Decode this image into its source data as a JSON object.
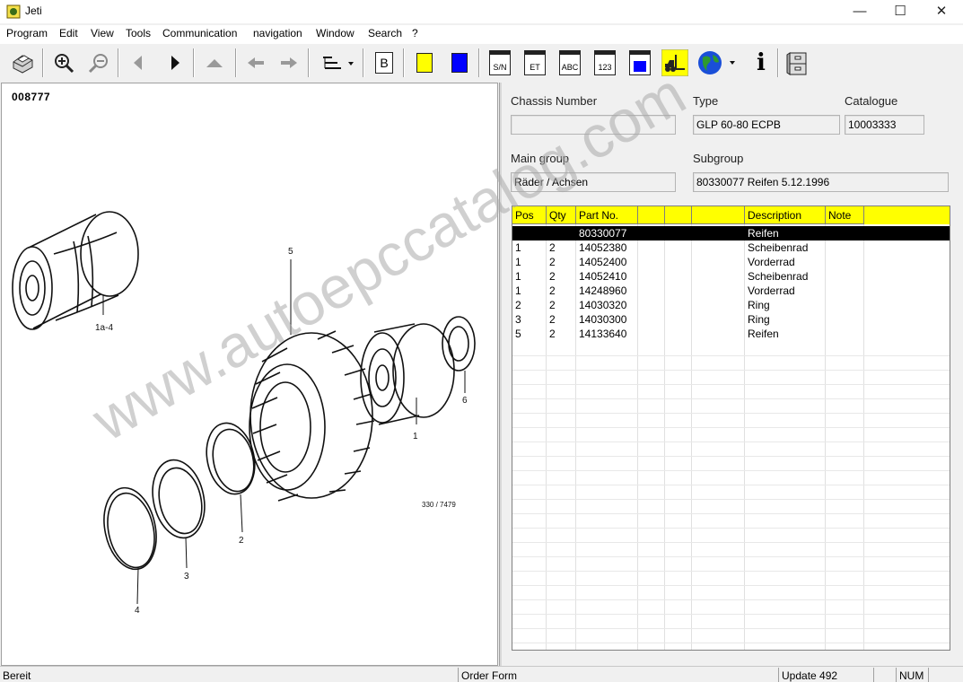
{
  "window": {
    "title": "Jeti",
    "minimize": "—",
    "maximize": "☐",
    "close": "✕"
  },
  "menu": [
    "Program",
    "Edit",
    "View",
    "Tools",
    "Communication",
    "navigation",
    "Window",
    "Search",
    "?"
  ],
  "toolbar": {
    "card_sn": "S/N",
    "card_et": "ET",
    "card_abc": "ABC",
    "card_123": "123",
    "bookmark": "B",
    "info": "i"
  },
  "drawing": {
    "reference": "008777",
    "callouts": [
      "5",
      "1a-4",
      "1",
      "6",
      "2",
      "3",
      "4"
    ],
    "drawing_code": "330 / 7479"
  },
  "fields": {
    "chassis_label": "Chassis Number",
    "chassis_value": "",
    "type_label": "Type",
    "type_value": "GLP 60-80 ECPB",
    "catalogue_label": "Catalogue",
    "catalogue_value": "10003333",
    "main_group_label": "Main group",
    "main_group_value": "Räder / Achsen",
    "subgroup_label": "Subgroup",
    "subgroup_value": "80330077  Reifen 5.12.1996"
  },
  "table": {
    "columns": [
      "Pos",
      "Qty",
      "Part No.",
      "",
      "",
      "",
      "Description",
      "Note"
    ],
    "rows": [
      {
        "pos": "",
        "qty": "",
        "part": "80330077",
        "desc": "Reifen",
        "note": ""
      },
      {
        "pos": "1",
        "qty": "2",
        "part": "14052380",
        "desc": "Scheibenrad",
        "note": ""
      },
      {
        "pos": "1",
        "qty": "2",
        "part": "14052400",
        "desc": "Vorderrad",
        "note": ""
      },
      {
        "pos": "1",
        "qty": "2",
        "part": "14052410",
        "desc": "Scheibenrad",
        "note": ""
      },
      {
        "pos": "1",
        "qty": "2",
        "part": "14248960",
        "desc": "Vorderrad",
        "note": ""
      },
      {
        "pos": "2",
        "qty": "2",
        "part": "14030320",
        "desc": "Ring",
        "note": ""
      },
      {
        "pos": "3",
        "qty": "2",
        "part": "14030300",
        "desc": "Ring",
        "note": ""
      },
      {
        "pos": "5",
        "qty": "2",
        "part": "14133640",
        "desc": "Reifen",
        "note": ""
      }
    ]
  },
  "status": {
    "ready": "Bereit",
    "order_form": "Order Form",
    "update": "Update 492",
    "num": "NUM"
  },
  "watermark": "www.autoepccatalog.com",
  "colors": {
    "header_bg": "#ffff00",
    "selected_row_bg": "#000000",
    "button_yellow": "#ffff00",
    "button_blue": "#0000ff"
  }
}
